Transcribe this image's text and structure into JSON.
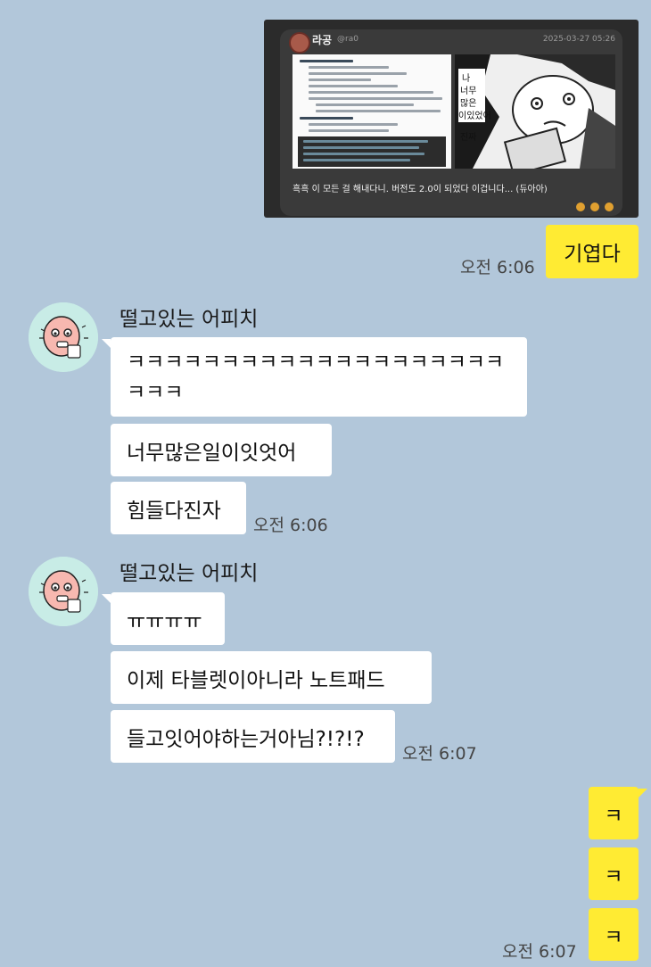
{
  "card": {
    "author_name": "라공",
    "author_handle": "@ra0",
    "date": "2025-03-27 05:26",
    "caption": "흑흑 이 모든 걸 해내다니. 버전도 2.0이 되었다 이겁니다... (듀아아)",
    "manga_text": "나 너무 많은 이 있었어 진짜",
    "code_lines": [
      "--color-p: #aa0000;",
      "--color-pd: #7d0000;",
      "--color-pl: #d80000;",
      "--color-acc: #E5C67F;"
    ]
  },
  "messages": {
    "me_1": {
      "text": "기엽다",
      "time": "오전 6:06"
    },
    "group_1": {
      "sender": "떨고있는 어피치",
      "line1": "ㅋㅋㅋㅋㅋㅋㅋㅋㅋㅋㅋㅋㅋㅋㅋㅋㅋㅋㅋㅋ",
      "line2": "ㅋㅋㅋ",
      "msg2": "너무많은일이잇엇어",
      "msg3": "힘들다진자",
      "time": "오전 6:06"
    },
    "group_2": {
      "sender": "떨고있는 어피치",
      "msg1": "ㅠㅠㅠㅠ",
      "msg2": "이제 타블렛이아니라 노트패드",
      "msg3": "들고잇어야하는거아님?!?!?",
      "time": "오전 6:07"
    },
    "me_2": {
      "items": [
        "ㅋ",
        "ㅋ",
        "ㅋ"
      ],
      "time": "오전 6:07"
    }
  },
  "colors": {
    "background": "#b2c7da",
    "my_bubble": "#ffeb33",
    "other_bubble": "#ffffff",
    "avatar_bg": "#c8ece6"
  }
}
